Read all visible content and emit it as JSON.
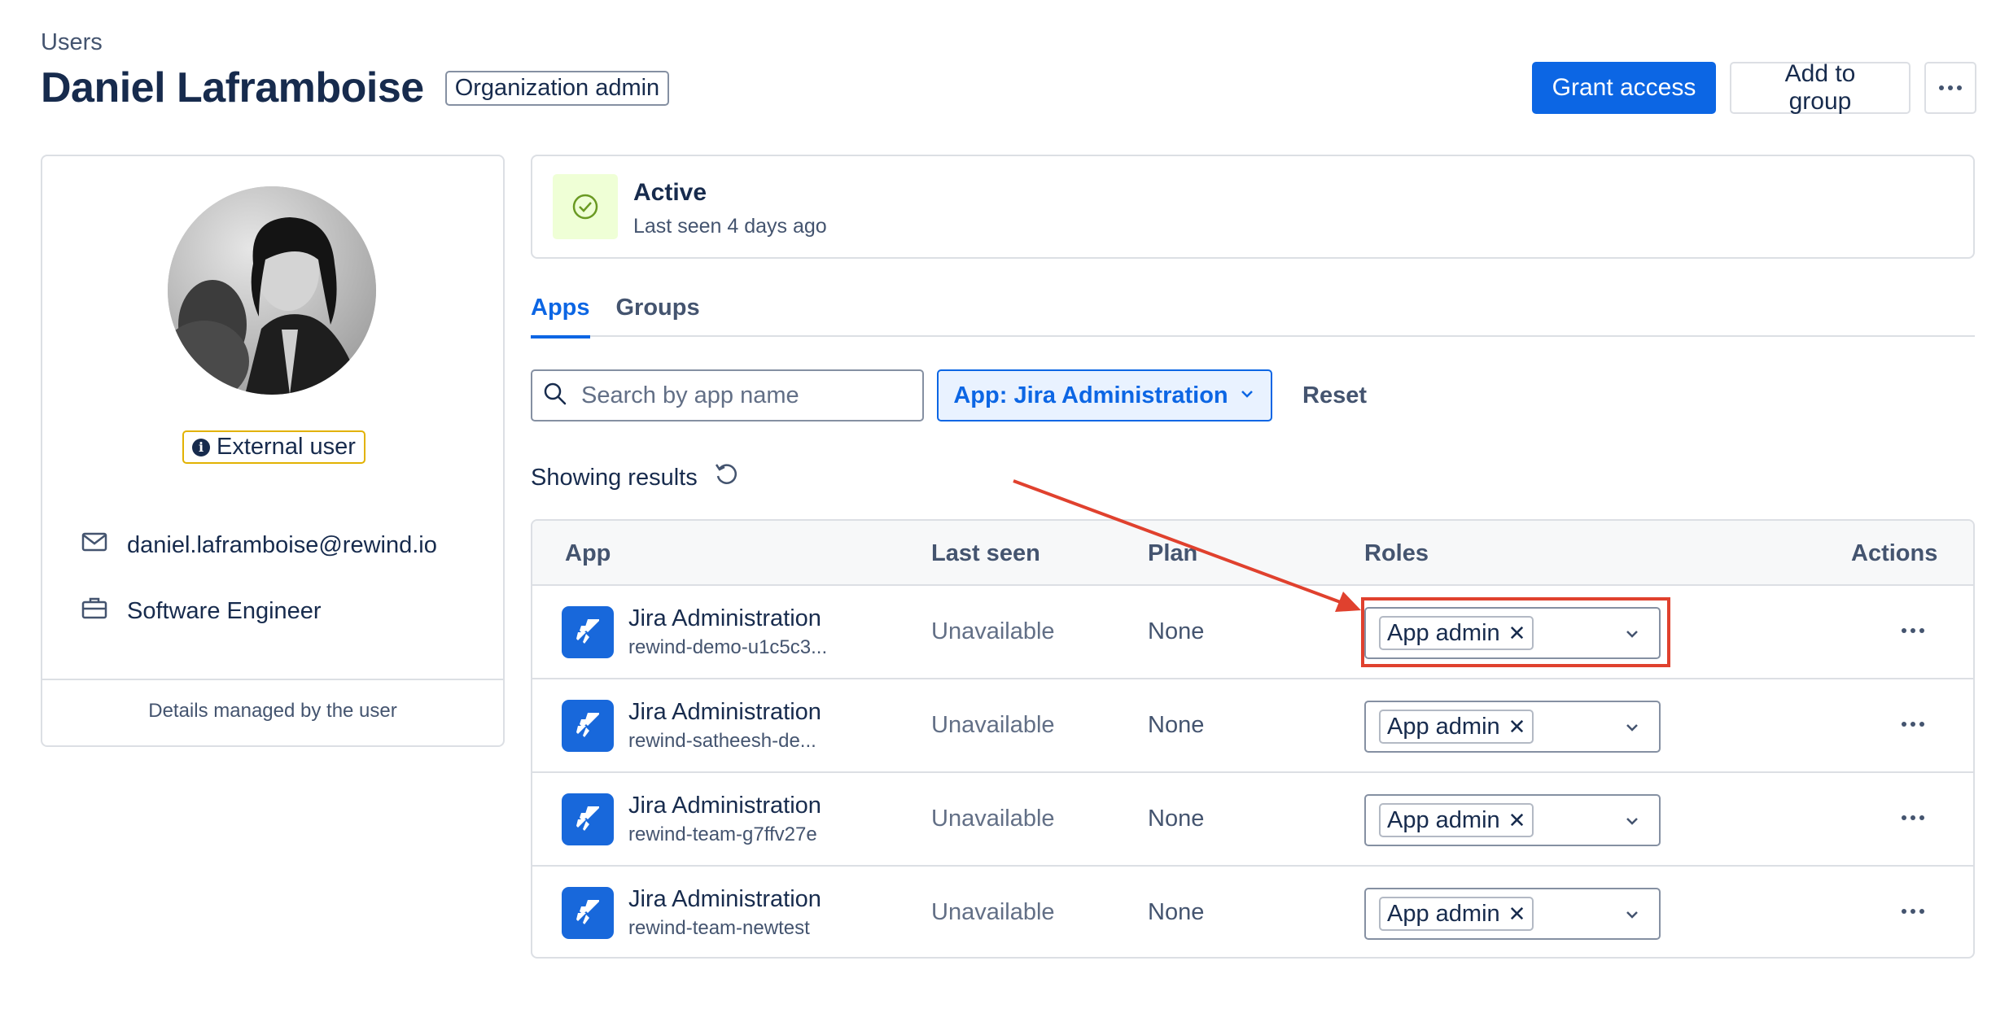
{
  "header": {
    "breadcrumb": "Users",
    "title": "Daniel Laframboise",
    "role_badge": "Organization admin",
    "grant_access_label": "Grant access",
    "add_to_group_label": "Add to group"
  },
  "profile": {
    "external_badge": "External user",
    "email": "daniel.laframboise@rewind.io",
    "job_title": "Software Engineer",
    "footer": "Details managed by the user"
  },
  "status": {
    "title": "Active",
    "last_seen": "Last seen 4 days ago",
    "accent_color": "#6a9a23"
  },
  "tabs": [
    {
      "label": "Apps",
      "active": true
    },
    {
      "label": "Groups",
      "active": false
    }
  ],
  "filters": {
    "search_placeholder": "Search by app name",
    "app_filter_label": "App: Jira Administration",
    "reset_label": "Reset",
    "showing_results": "Showing results"
  },
  "table": {
    "headers": {
      "app": "App",
      "last_seen": "Last seen",
      "plan": "Plan",
      "roles": "Roles",
      "actions": "Actions"
    },
    "rows": [
      {
        "app_name": "Jira Administration",
        "site": "rewind-demo-u1c5c3...",
        "last_seen": "Unavailable",
        "plan": "None",
        "role": "App admin"
      },
      {
        "app_name": "Jira Administration",
        "site": "rewind-satheesh-de...",
        "last_seen": "Unavailable",
        "plan": "None",
        "role": "App admin"
      },
      {
        "app_name": "Jira Administration",
        "site": "rewind-team-g7ffv27e",
        "last_seen": "Unavailable",
        "plan": "None",
        "role": "App admin"
      },
      {
        "app_name": "Jira Administration",
        "site": "rewind-team-newtest",
        "last_seen": "Unavailable",
        "plan": "None",
        "role": "App admin"
      }
    ]
  },
  "colors": {
    "primary": "#0c66e4",
    "annotation": "#e0412e",
    "external_badge_border": "#e2b203",
    "app_icon": "#1868db"
  },
  "icons": {
    "email": "envelope-icon",
    "job": "briefcase-icon",
    "status": "check-circle-icon",
    "search": "search-icon",
    "refresh": "refresh-icon",
    "app": "jira-icon",
    "more": "more-icon"
  }
}
